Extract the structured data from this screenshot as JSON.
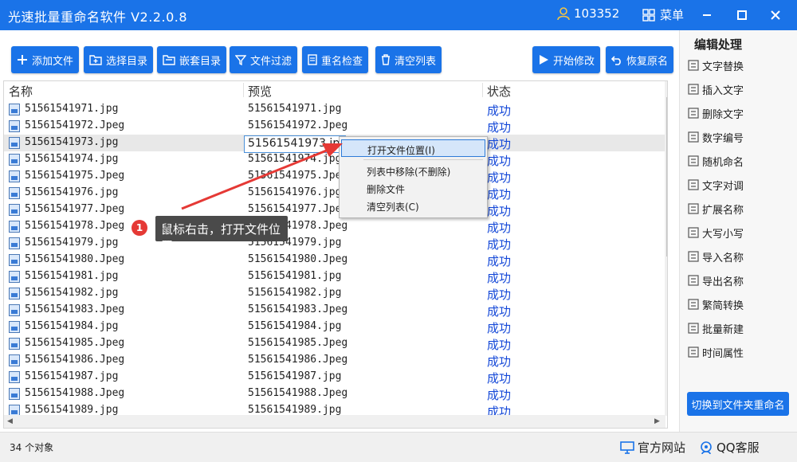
{
  "app": {
    "title": "光速批量重命名软件 V2.2.0.8",
    "user_id": "103352",
    "menu_label": "菜单"
  },
  "toolbar": {
    "add_file": "添加文件",
    "select_dir": "选择目录",
    "nested_dir": "嵌套目录",
    "file_filter": "文件过滤",
    "rename_check": "重名检查",
    "clear_list": "清空列表",
    "start_modify": "开始修改",
    "restore_name": "恢复原名"
  },
  "table": {
    "headers": {
      "name": "名称",
      "preview": "预览",
      "status": "状态"
    },
    "rows": [
      {
        "name": "51561541971.jpg",
        "preview": "51561541971.jpg",
        "status": "成功"
      },
      {
        "name": "51561541972.Jpeg",
        "preview": "51561541972.Jpeg",
        "status": "成功"
      },
      {
        "name": "51561541973.jpg",
        "preview": "51561541973.jpg",
        "status": "成功"
      },
      {
        "name": "51561541974.jpg",
        "preview": "51561541974.jpg",
        "status": "成功"
      },
      {
        "name": "51561541975.Jpeg",
        "preview": "51561541975.Jpeg",
        "status": "成功"
      },
      {
        "name": "51561541976.jpg",
        "preview": "51561541976.jpg",
        "status": "成功"
      },
      {
        "name": "51561541977.Jpeg",
        "preview": "51561541977.Jpeg",
        "status": "成功"
      },
      {
        "name": "51561541978.Jpeg",
        "preview": "51561541978.Jpeg",
        "status": "成功"
      },
      {
        "name": "51561541979.jpg",
        "preview": "51561541979.jpg",
        "status": "成功"
      },
      {
        "name": "51561541980.Jpeg",
        "preview": "51561541980.Jpeg",
        "status": "成功"
      },
      {
        "name": "51561541981.jpg",
        "preview": "51561541981.jpg",
        "status": "成功"
      },
      {
        "name": "51561541982.jpg",
        "preview": "51561541982.jpg",
        "status": "成功"
      },
      {
        "name": "51561541983.Jpeg",
        "preview": "51561541983.Jpeg",
        "status": "成功"
      },
      {
        "name": "51561541984.jpg",
        "preview": "51561541984.jpg",
        "status": "成功"
      },
      {
        "name": "51561541985.Jpeg",
        "preview": "51561541985.Jpeg",
        "status": "成功"
      },
      {
        "name": "51561541986.Jpeg",
        "preview": "51561541986.Jpeg",
        "status": "成功"
      },
      {
        "name": "51561541987.jpg",
        "preview": "51561541987.jpg",
        "status": "成功"
      },
      {
        "name": "51561541988.Jpeg",
        "preview": "51561541988.Jpeg",
        "status": "成功"
      },
      {
        "name": "51561541989.jpg",
        "preview": "51561541989.jpg",
        "status": "成功"
      }
    ],
    "edit_value": "51561541973.jpg"
  },
  "context_menu": {
    "open_location": "打开文件位置(I)",
    "remove_from_list": "列表中移除(不删除)",
    "delete_file": "删除文件",
    "clear_list": "清空列表(C)"
  },
  "callout": {
    "badge": "1",
    "text": "鼠标右击，打开文件位置"
  },
  "right_panel": {
    "title": "编辑处理",
    "items": [
      "文字替换",
      "插入文字",
      "删除文字",
      "数字编号",
      "随机命名",
      "文字对调",
      "扩展名称",
      "大写小写",
      "导入名称",
      "导出名称",
      "繁简转换",
      "批量新建",
      "时间属性"
    ],
    "switch_button": "切换到文件夹重命名"
  },
  "status": {
    "count": "34 个对象",
    "official_site": "官方网站",
    "qq_service": "QQ客服"
  },
  "colors": {
    "accent": "#1a73e8",
    "success_text": "#1448d8"
  }
}
